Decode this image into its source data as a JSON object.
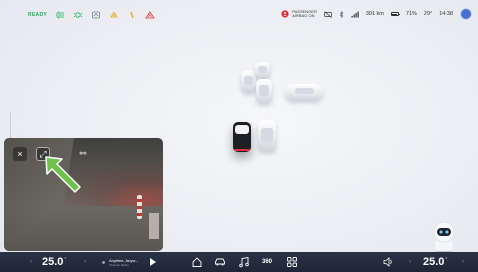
{
  "status": {
    "ready": "READY",
    "airbag_line1": "PASSENGER",
    "airbag_line2": "AIRBAG ON",
    "range": "391 km",
    "battery": "71%",
    "outside_temp": "29°",
    "clock": "14:38",
    "left_icons": [
      "low-beam-icon",
      "parking-lights-icon",
      "auto-headlight-icon",
      "steering-assist-icon",
      "seatbelt-icon",
      "warning-triangle-icon"
    ],
    "right_icons": [
      "airbag-icon",
      "no-signal-icon",
      "bluetooth-icon",
      "cellular-icon",
      "battery-icon",
      "profile-avatar"
    ]
  },
  "camera": {
    "close_icon": "×",
    "expand_icon": "⤢",
    "extra_icon": "⚯"
  },
  "climate": {
    "left_temp": "25.0",
    "right_temp": "25.0",
    "unit": "°"
  },
  "media": {
    "title": "Anytime, Anyw...",
    "subtitle": "Chinese Radio"
  },
  "dock": {
    "icons": [
      "home-icon",
      "car-icon",
      "music-icon",
      "camera-360-icon",
      "apps-icon"
    ],
    "label_360": "360"
  },
  "colors": {
    "ready_green": "#19b35a",
    "bottom_bar": "#1e2536",
    "arrow_green": "#6cc24a",
    "ego_taillight": "#e0303a"
  }
}
